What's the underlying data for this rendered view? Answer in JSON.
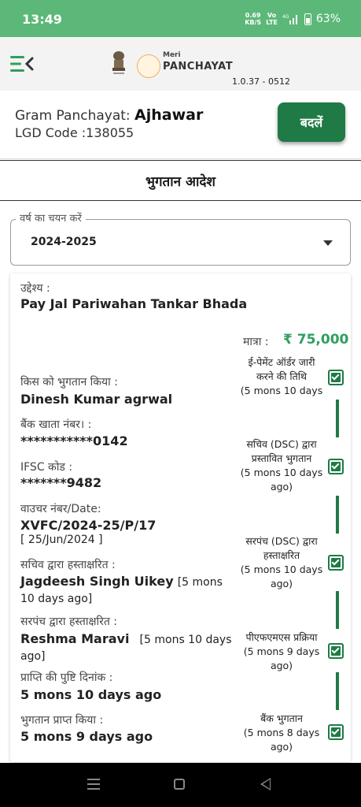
{
  "status_bar": {
    "time": "13:49",
    "speed_value": "0.69",
    "speed_unit": "KB/S",
    "volte_top": "Vo",
    "volte_bottom": "LTE",
    "network": "4G",
    "battery": "63%"
  },
  "header": {
    "logo_top": "Meri",
    "logo_main": "PANCHAYAT",
    "version": "1.0.37 - 0512"
  },
  "panchayat": {
    "label": "Gram Panchayat:",
    "name": "Ajhawar",
    "lgd_label": "LGD Code :",
    "lgd_code": "138055",
    "change_label": "बदलें"
  },
  "page_title": "भुगतान आदेश",
  "year_select": {
    "legend": "वर्ष का चयन करें",
    "value": "2024-2025"
  },
  "payment": {
    "purpose_label": "उद्देश्य :",
    "purpose_value": "Pay Jal Pariwahan Tankar Bhada",
    "amount_label": "मात्रा :",
    "amount_value": "₹ 75,000",
    "paid_to_label": "किस को भुगतान किया :",
    "paid_to_value": "Dinesh Kumar agrwal",
    "account_label": "बैंक खाता नंबर। :",
    "account_value": "***********0142",
    "ifsc_label": "IFSC कोड :",
    "ifsc_value": "*******9482",
    "voucher_label": "वाउचर नंबर/Date:",
    "voucher_value": "XVFC/2024-25/P/17",
    "voucher_date": "[ 25/Jun/2024 ]",
    "secretary_label": "सचिव द्वारा हस्ताक्षरित :",
    "secretary_name": "Jagdeesh Singh Uikey",
    "secretary_time_1": "[5 mons",
    "secretary_time_2": "10 days ago]",
    "sarpanch_label": "सरपंच द्वारा हस्ताक्षरित :",
    "sarpanch_name": "Reshma Maravi",
    "sarpanch_time_1": "[5 mons 10 days",
    "sarpanch_time_2": "ago]",
    "receipt_confirm_label": "प्राप्ति की पुष्टि दिनांक :",
    "receipt_confirm_value": "5 mons 10 days ago",
    "payment_received_label": "भुगतान प्राप्त किया :",
    "payment_received_value": "5 mons 9 days ago"
  },
  "steps": [
    {
      "line1": "ई-पेमेंट ऑर्डर जारी",
      "line2": "करने की तिथि",
      "line3": "(5 mons 10 days",
      "line4": ""
    },
    {
      "line1": "सचिव (DSC) द्वारा",
      "line2": "प्रस्तावित भुगतान",
      "line3": "(5 mons 10 days",
      "line4": "ago)"
    },
    {
      "line1": "सरपंच (DSC) द्वारा",
      "line2": "हस्ताक्षरित",
      "line3": "(5 mons 10 days",
      "line4": "ago)"
    },
    {
      "line1": "पीएफएमएस प्रक्रिया",
      "line2": "(5 mons 9 days",
      "line3": "ago)",
      "line4": ""
    },
    {
      "line1": "बैंक भुगतान",
      "line2": "(5 mons 8 days",
      "line3": "ago)",
      "line4": ""
    }
  ],
  "colors": {
    "status_green": "#5cb878",
    "button_green": "#1f7a45",
    "amount_green": "#2e9e5e"
  }
}
